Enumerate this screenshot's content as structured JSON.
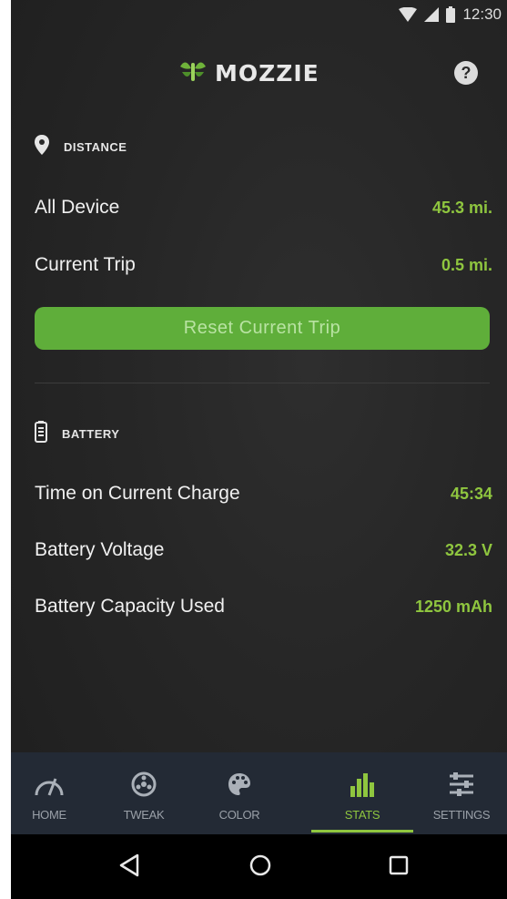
{
  "status_bar": {
    "time": "12:30"
  },
  "header": {
    "brand": "MOZZIE",
    "help_glyph": "?"
  },
  "distance": {
    "title": "DISTANCE",
    "rows": [
      {
        "label": "All Device",
        "value": "45.3 mi."
      },
      {
        "label": "Current Trip",
        "value": "0.5 mi."
      }
    ],
    "reset_label": "Reset Current Trip"
  },
  "battery": {
    "title": "BATTERY",
    "rows": [
      {
        "label": "Time on Current Charge",
        "value": "45:34"
      },
      {
        "label": "Battery Voltage",
        "value": "32.3 V"
      },
      {
        "label": "Battery Capacity Used",
        "value": "1250 mAh"
      }
    ]
  },
  "nav": {
    "items": [
      {
        "label": "HOME",
        "icon": "gauge-icon"
      },
      {
        "label": "TWEAK",
        "icon": "wheel-icon"
      },
      {
        "label": "COLOR",
        "icon": "palette-icon"
      },
      {
        "label": "STATS",
        "icon": "bar-chart-icon",
        "active": true
      },
      {
        "label": "SETTINGS",
        "icon": "sliders-icon"
      }
    ]
  },
  "colors": {
    "accent": "#8fc63f",
    "button": "#5fae3a",
    "nav_bg": "#232a35"
  }
}
